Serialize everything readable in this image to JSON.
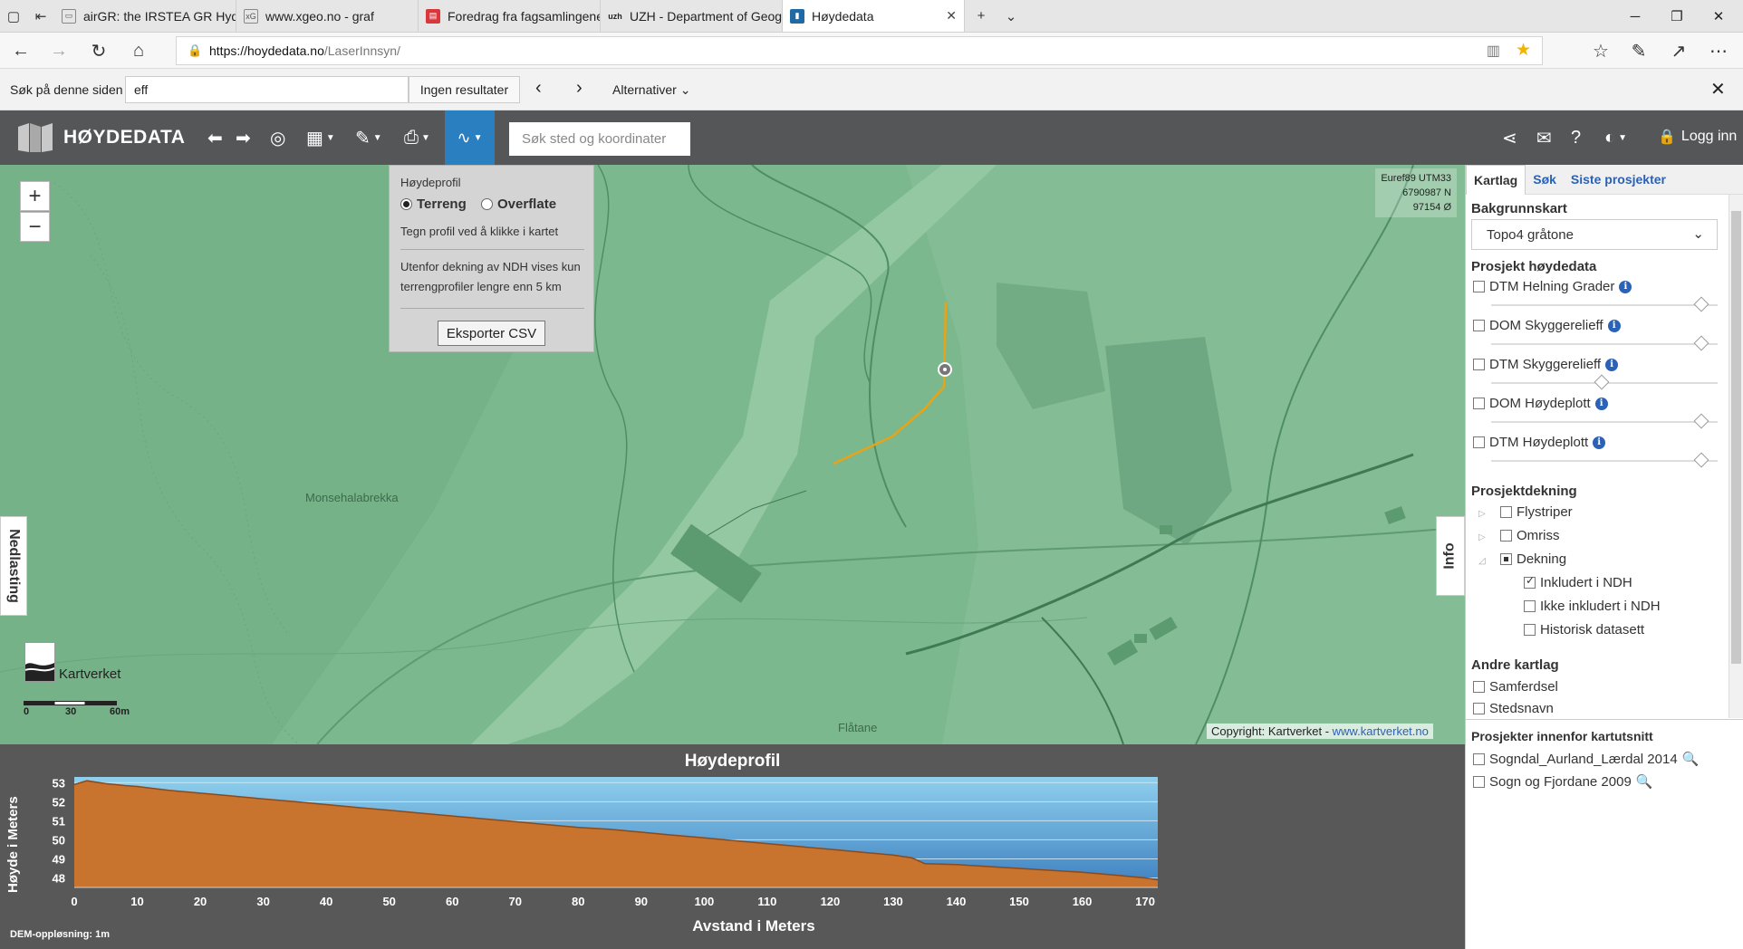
{
  "browser": {
    "tabs": [
      {
        "title": "airGR: the IRSTEA GR Hydro",
        "icon": "page-icon"
      },
      {
        "title": "www.xgeo.no - graf",
        "icon": "xgeo-favicon"
      },
      {
        "title": "Foredrag fra fagsamlingene",
        "icon": "red-favicon"
      },
      {
        "title": "UZH - Department of Geog",
        "icon": "uzh-favicon"
      },
      {
        "title": "Høydedata",
        "icon": "hoydedata-favicon"
      }
    ],
    "url_host": "https://hoydedata.no",
    "url_path": "/LaserInnsyn/"
  },
  "find": {
    "label": "Søk på denne siden",
    "query": "eff",
    "result": "Ingen resultater",
    "options": "Alternativer"
  },
  "app": {
    "title": "HØYDEDATA",
    "search_placeholder": "Søk sted og koordinater",
    "login": "Logg inn",
    "accent": "#2a7fc0"
  },
  "map": {
    "coords": {
      "line1": "Euref89 UTM33",
      "line2": "6790987 N",
      "line3": "97154 Ø"
    },
    "labels": {
      "monsehalabrekka": "Monsehalabrekka",
      "flatane": "Flåtane"
    },
    "kartverket": "Kartverket",
    "scale": [
      "0",
      "30",
      "60m"
    ],
    "copyright": "Copyright: Kartverket - ",
    "copyright_link": "www.kartverket.no",
    "nedlasting": "Nedlasting",
    "info": "Info",
    "profile_line_color": "#e8a317"
  },
  "hoydeprofil_panel": {
    "title": "Høydeprofil",
    "option_terreng": "Terreng",
    "option_overflate": "Overflate",
    "selected": "Terreng",
    "hint": "Tegn profil ved å klikke i kartet",
    "warning": "Utenfor dekning av NDH vises kun terrengprofiler lengre enn 5 km",
    "export": "Eksporter CSV"
  },
  "sidebar": {
    "tabs": [
      "Kartlag",
      "Søk",
      "Siste prosjekter"
    ],
    "active_tab": "Kartlag",
    "bakgrunnskart_label": "Bakgrunnskart",
    "bakgrunnskart_value": "Topo4 gråtone",
    "prosjekt_hoydedata_label": "Prosjekt høydedata",
    "layers": [
      {
        "name": "DTM Helning Grader",
        "checked": false,
        "opacity": 0.95
      },
      {
        "name": "DOM Skyggerelieff",
        "checked": false,
        "opacity": 0.95
      },
      {
        "name": "DTM Skyggerelieff",
        "checked": false,
        "opacity": 0.5
      },
      {
        "name": "DOM Høydeplott",
        "checked": false,
        "opacity": 0.95
      },
      {
        "name": "DTM Høydeplott",
        "checked": false,
        "opacity": 0.95
      }
    ],
    "prosjektdekning_label": "Prosjektdekning",
    "dekning": [
      {
        "name": "Flystriper",
        "state": "unchecked"
      },
      {
        "name": "Omriss",
        "state": "unchecked"
      },
      {
        "name": "Dekning",
        "state": "partial"
      }
    ],
    "dekning_sub": [
      {
        "name": "Inkludert i NDH",
        "state": "checked"
      },
      {
        "name": "Ikke inkludert i NDH",
        "state": "unchecked"
      },
      {
        "name": "Historisk datasett",
        "state": "unchecked"
      }
    ],
    "andre_kartlag_label": "Andre kartlag",
    "andre": [
      {
        "name": "Samferdsel",
        "checked": false
      },
      {
        "name": "Stedsnavn",
        "checked": false
      }
    ],
    "prosjekter_label": "Prosjekter innenfor kartutsnitt",
    "prosjekter": [
      {
        "name": "Sogndal_Aurland_Lærdal 2014",
        "checked": false
      },
      {
        "name": "Sogn og Fjordane 2009",
        "checked": false
      }
    ]
  },
  "chart_data": {
    "type": "area",
    "title": "Høydeprofil",
    "xlabel": "Avstand i Meters",
    "ylabel": "Høyde i Meters",
    "xlim": [
      0,
      172
    ],
    "ylim": [
      47.5,
      53.3
    ],
    "xticks": [
      0,
      10,
      20,
      30,
      40,
      50,
      60,
      70,
      80,
      90,
      100,
      110,
      120,
      130,
      140,
      150,
      160,
      170
    ],
    "yticks": [
      48,
      49,
      50,
      51,
      52,
      53
    ],
    "series": [
      {
        "x": [
          0,
          2,
          5,
          8,
          10,
          15,
          20,
          25,
          30,
          35,
          40,
          45,
          50,
          55,
          60,
          65,
          70,
          75,
          80,
          85,
          90,
          95,
          100,
          105,
          110,
          115,
          120,
          125,
          130,
          133,
          135,
          140,
          145,
          150,
          155,
          160,
          165,
          170,
          172
        ],
        "values": [
          52.9,
          53.1,
          52.95,
          52.85,
          52.8,
          52.6,
          52.45,
          52.3,
          52.15,
          52.0,
          51.85,
          51.7,
          51.55,
          51.4,
          51.25,
          51.1,
          50.95,
          50.8,
          50.65,
          50.55,
          50.4,
          50.25,
          50.1,
          49.95,
          49.8,
          49.65,
          49.5,
          49.35,
          49.2,
          49.05,
          48.75,
          48.7,
          48.6,
          48.5,
          48.4,
          48.3,
          48.15,
          48.0,
          47.9
        ]
      }
    ],
    "colors": {
      "fill": "#c8732e",
      "sky_top": "#7fc7e8",
      "sky_bottom": "#3f86c6"
    },
    "note": "DEM-oppløsning: 1m"
  }
}
